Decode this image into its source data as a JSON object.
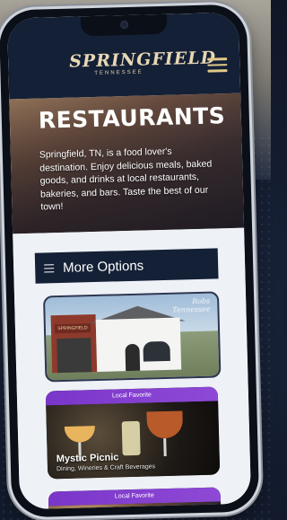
{
  "header": {
    "logo_main": "SPRINGFIELD",
    "logo_sub": "TENNESSEE",
    "menu_icon": "hamburger-icon"
  },
  "hero": {
    "title": "RESTAURANTS",
    "description": "Springfield, TN, is a food lover's destination. Enjoy delicious meals, baked goods, and drinks at local restaurants, bakeries, and bars. Taste the best of our town!"
  },
  "more_options": {
    "label": "More Options",
    "icon": "hamburger-icon"
  },
  "featured_image": {
    "watermark_line1": "Robs",
    "watermark_line2": "Tennessee",
    "sign_text": "SPRINGFIELD"
  },
  "listings": [
    {
      "badge": "Local Favorite",
      "name": "Mystic Picnic",
      "description": "Dining, Wineries & Craft Beverages"
    },
    {
      "badge": "Local Favorite"
    }
  ],
  "colors": {
    "header_bg": "#142036",
    "logo_color": "#e7d8b4",
    "menu_icon_color": "#e0c98a",
    "badge_purple": "#7a36c9",
    "content_bg": "#eef1f6"
  }
}
